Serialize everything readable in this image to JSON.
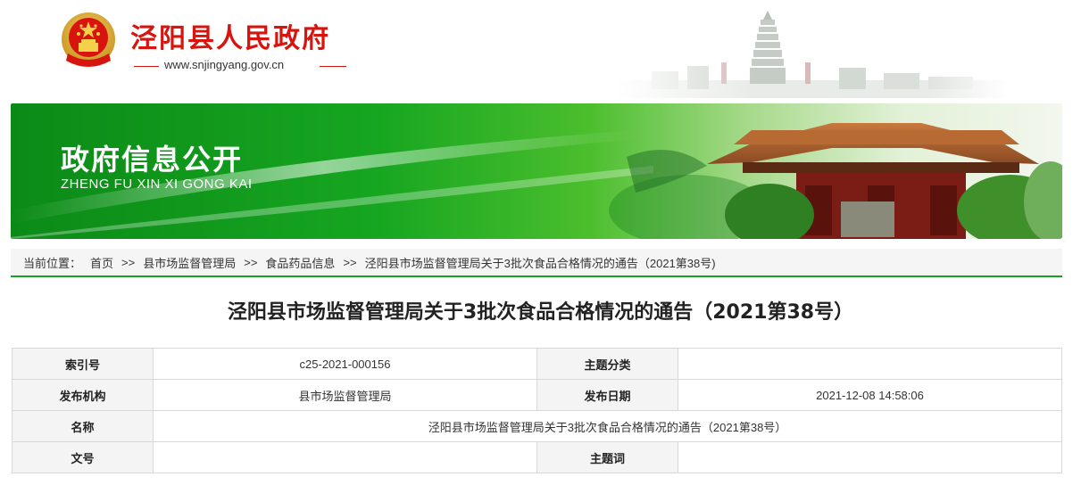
{
  "header": {
    "site_name": "泾阳县人民政府",
    "site_url": "www.snjingyang.gov.cn",
    "emblem_icon": "national-emblem-icon"
  },
  "banner": {
    "title": "政府信息公开",
    "subtitle": "ZHENG FU XIN XI GONG KAI"
  },
  "breadcrumb": {
    "label": "当前位置：",
    "separator": ">>",
    "items": [
      "首页",
      "县市场监督管理局",
      "食品药品信息",
      "泾阳县市场监督管理局关于3批次食品合格情况的通告（2021第38号)"
    ]
  },
  "article": {
    "title": "泾阳县市场监督管理局关于3批次食品合格情况的通告（2021第38号）"
  },
  "meta": {
    "index_label": "索引号",
    "index_value": "c25-2021-000156",
    "category_label": "主题分类",
    "category_value": "",
    "publisher_label": "发布机构",
    "publisher_value": "县市场监督管理局",
    "date_label": "发布日期",
    "date_value": "2021-12-08 14:58:06",
    "name_label": "名称",
    "name_value": "泾阳县市场监督管理局关于3批次食品合格情况的通告（2021第38号）",
    "doc_no_label": "文号",
    "doc_no_value": "",
    "keywords_label": "主题词",
    "keywords_value": ""
  },
  "colors": {
    "brand_red": "#d8140f",
    "brand_green": "#1aa024"
  }
}
